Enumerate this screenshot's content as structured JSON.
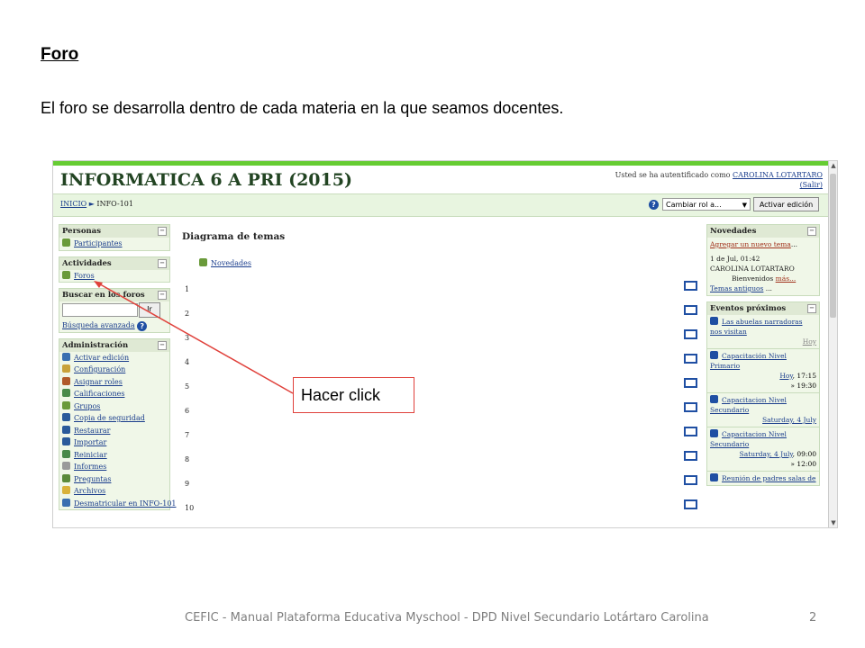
{
  "document": {
    "heading": "Foro",
    "intro": "El foro se desarrolla dentro de cada materia en la que seamos docentes.",
    "footer": "CEFIC - Manual Plataforma Educativa Myschool - DPD Nivel Secundario Lotártaro Carolina",
    "page_number": "2",
    "callout": "Hacer click"
  },
  "screenshot": {
    "course_title": "INFORMATICA 6 A PRI (2015)",
    "auth": {
      "prefix": "Usted se ha autentificado como",
      "user": "CAROLINA LOTARTARO",
      "logout": "(Salir)"
    },
    "breadcrumb": {
      "home": "INICIO",
      "separator": "►",
      "current": "INFO-101"
    },
    "role_select": "Cambiar rol a...",
    "edit_button": "Activar edición",
    "left": {
      "personas": {
        "title": "Personas",
        "items": [
          "Participantes"
        ]
      },
      "actividades": {
        "title": "Actividades",
        "items": [
          "Foros"
        ]
      },
      "buscar": {
        "title": "Buscar en los foros",
        "button": "Ir",
        "advanced": "Búsqueda avanzada"
      },
      "administracion": {
        "title": "Administración",
        "items": [
          "Activar edición",
          "Configuración",
          "Asignar roles",
          "Calificaciones",
          "Grupos",
          "Copia de seguridad",
          "Restaurar",
          "Importar",
          "Reiniciar",
          "Informes",
          "Preguntas",
          "Archivos",
          "Desmatricular en INFO-101"
        ]
      }
    },
    "main": {
      "title": "Diagrama de temas",
      "news_link": "Novedades",
      "sections": [
        "1",
        "2",
        "3",
        "4",
        "5",
        "6",
        "7",
        "8",
        "9",
        "10"
      ]
    },
    "right": {
      "novedades": {
        "title": "Novedades",
        "add_link": "Agregar un nuevo tema",
        "add_suffix": "...",
        "date": "1 de Jul, 01:42",
        "author": "CAROLINA LOTARTARO",
        "message": "Bienvenidos",
        "more": "más...",
        "older": "Temas antiguos",
        "older_suffix": " ..."
      },
      "eventos": {
        "title": "Eventos próximos",
        "items": [
          {
            "name": "Las abuelas narradoras nos visitan",
            "date": "Hoy",
            "time": ""
          },
          {
            "name": "Capacitación Nivel Primario",
            "date": "Hoy",
            "time": ", 17:15",
            "end": "» 19:30"
          },
          {
            "name": "Capacitacion Nivel Secundario",
            "date": "Saturday, 4 July",
            "time": ""
          },
          {
            "name": "Capacitacion Nivel Secundario",
            "date": "Saturday, 4 July",
            "time": ", 09:00",
            "end": "» 12:00"
          },
          {
            "name": "Reunión de padres salas de",
            "date": "",
            "time": ""
          }
        ]
      }
    }
  },
  "colors": {
    "accent_green": "#66cc33",
    "link_blue": "#1a3d8c",
    "block_bg": "#f0f7e8",
    "callout_red": "#e0413b"
  },
  "icons": [
    "help-icon",
    "participants-icon",
    "forum-icon",
    "section-toggle-icon",
    "calendar-event-icon",
    "collapse-icon"
  ]
}
